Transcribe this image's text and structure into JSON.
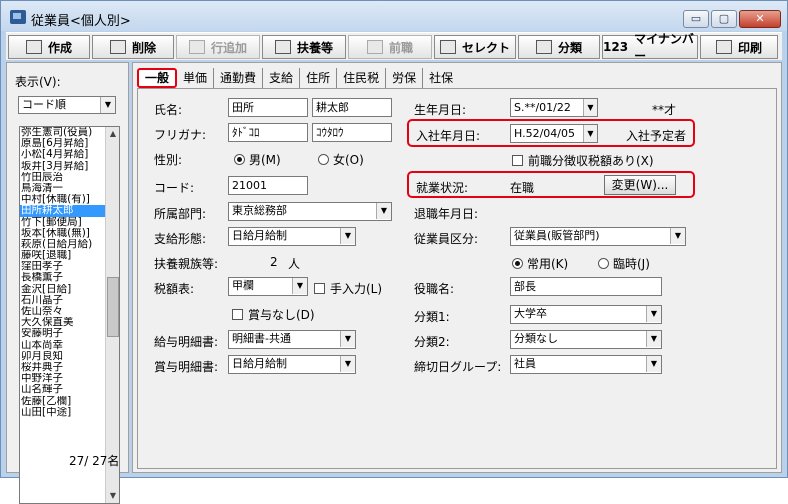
{
  "window": {
    "title": "従業員<個人別>",
    "min": "▭",
    "max": "▢",
    "close": "✕"
  },
  "toolbar": {
    "create": "作成",
    "delete": "削除",
    "add_row": "行追加",
    "dependents": "扶養等",
    "prev_job": "前職",
    "select": "セレクト",
    "category": "分類",
    "mynumber": "マイナンバー",
    "print": "印刷",
    "mynumber_prefix": "123"
  },
  "left": {
    "display_label": "表示(V):",
    "sort_value": "コード順",
    "count": "27/ 27名",
    "employees": [
      "弥生憲司(役員)",
      "原島[6月昇給]",
      "小松[4月昇給]",
      "坂井[3月昇給]",
      "竹田辰治",
      "鳥海清一",
      "中村[休職(有)]",
      "田所耕太郎",
      "竹下[郵便局]",
      "坂本[休職(無)]",
      "萩原(日給月給)",
      "藤咲[退職]",
      "窪田孝子",
      "長橋薫子",
      "金沢[日給]",
      "石川晶子",
      "佐山奈々",
      "大久保直美",
      "安藤明子",
      "山本尚幸",
      "卯月良知",
      "桜井典子",
      "中野洋子",
      "山名輝子",
      "佐藤[乙欄]",
      "山田[中途]"
    ],
    "selected_index": 7
  },
  "tabs": [
    "一般",
    "単価",
    "通勤費",
    "支給",
    "住所",
    "住民税",
    "労保",
    "社保"
  ],
  "form": {
    "name_label": "氏名:",
    "last_name": "田所",
    "first_name": "耕太郎",
    "kana_label": "フリガナ:",
    "last_kana": "ﾀﾄﾞｺﾛ",
    "first_kana": "ｺｳﾀﾛｳ",
    "gender_label": "性別:",
    "male": "男(M)",
    "female": "女(O)",
    "code_label": "コード:",
    "code": "21001",
    "dept_label": "所属部門:",
    "dept": "東京総務部",
    "paytype_label": "支給形態:",
    "paytype": "日給月給制",
    "dependents_label": "扶養親族等:",
    "dependents_count": "2",
    "dependents_unit": "人",
    "tax_label": "税額表:",
    "tax": "甲欄",
    "manual_input": "手入力(L)",
    "no_bonus": "賞与なし(D)",
    "payslip_label": "給与明細書:",
    "payslip": "明細書-共通",
    "bonus_slip_label": "賞与明細書:",
    "bonus_slip": "日給月給制",
    "birth_label": "生年月日:",
    "birth": "S.**/01/22",
    "age": "**才",
    "hire_label": "入社年月日:",
    "hire": "H.52/04/05",
    "hire_note": "入社予定者",
    "prev_tax": "前職分徴収税額あり(X)",
    "status_label": "就業状況:",
    "status": "在職",
    "change_btn": "変更(W)...",
    "retire_label": "退職年月日:",
    "emptype_label": "従業員区分:",
    "emptype": "従業員(販管部門)",
    "regular": "常用(K)",
    "temporary": "臨時(J)",
    "position_label": "役職名:",
    "position": "部長",
    "cat1_label": "分類1:",
    "cat1": "大学卒",
    "cat2_label": "分類2:",
    "cat2": "分類なし",
    "cutoff_label": "締切日グループ:",
    "cutoff": "社員"
  },
  "colors": {
    "highlight": "#e60012",
    "selection": "#3399ff"
  }
}
